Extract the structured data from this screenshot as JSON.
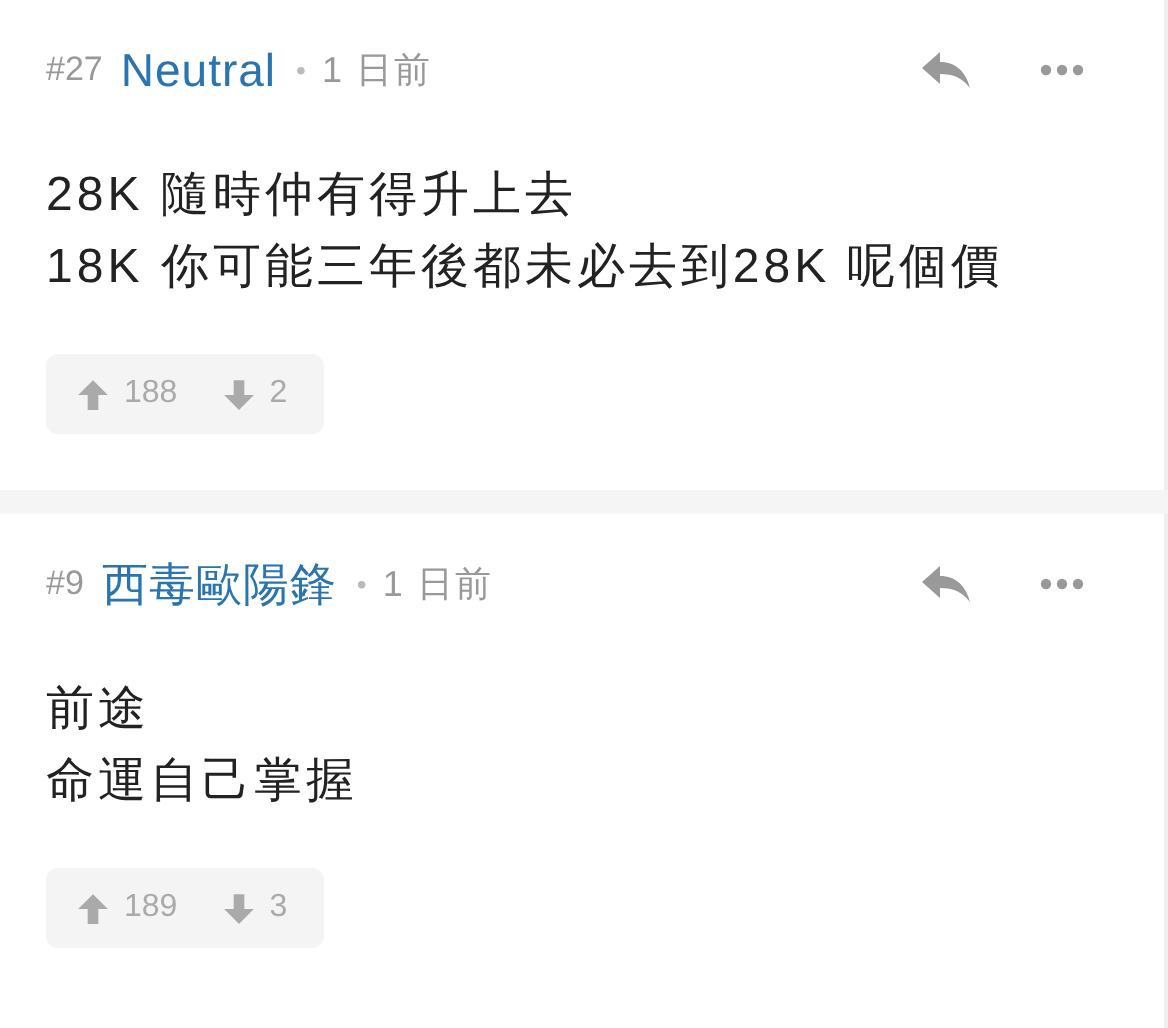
{
  "posts": [
    {
      "number": "#27",
      "author": "Neutral",
      "separator": "•",
      "time": "1 日前",
      "lines": [
        "28K 隨時仲有得升上去",
        "18K 你可能三年後都未必去到28K 呢個價"
      ],
      "upvotes": "188",
      "downvotes": "2"
    },
    {
      "number": "#9",
      "author": "西毒歐陽鋒",
      "separator": "•",
      "time": "1 日前",
      "lines": [
        "前途",
        "命運自己掌握"
      ],
      "upvotes": "189",
      "downvotes": "3"
    }
  ]
}
